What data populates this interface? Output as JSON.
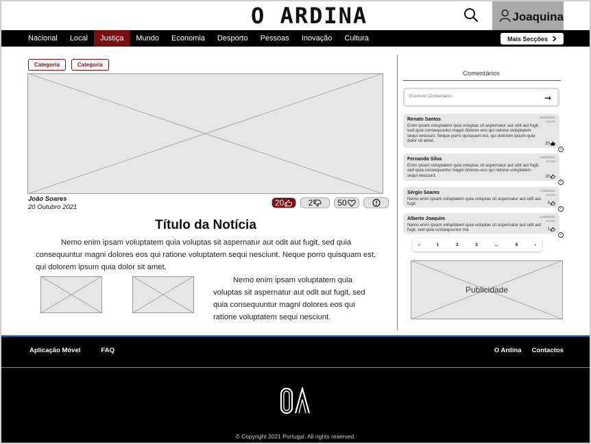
{
  "header": {
    "logo_text": "O ARDINA",
    "user_name": "Joaquina"
  },
  "nav": {
    "items": [
      {
        "label": "Nacional",
        "active": false
      },
      {
        "label": "Local",
        "active": false
      },
      {
        "label": "Justiça",
        "active": true
      },
      {
        "label": "Mundo",
        "active": false
      },
      {
        "label": "Economia",
        "active": false
      },
      {
        "label": "Desporto",
        "active": false
      },
      {
        "label": "Pessoas",
        "active": false
      },
      {
        "label": "Inovação",
        "active": false
      },
      {
        "label": "Cultura",
        "active": false
      }
    ],
    "more_label": "Mais Secções"
  },
  "article": {
    "categories": [
      "Categoria",
      "Categoria"
    ],
    "author": "João Soares",
    "date": "20 Outubro 2021",
    "likes": "20",
    "dislikes": "2",
    "favorites": "50",
    "title": "Título da Notícia",
    "paragraph1": "Nemo enim ipsam voluptatem quia voluptas sit aspernatur aut odit aut fugit, sed quia consequuntur magni dolores eos qui ratione voluptatem sequi nesciunt. Neque porro quisquam est, qui dolorem ipsum quia dolor sit amet.",
    "paragraph2": "Nemo enim ipsam voluptatem quia voluptas sit aspernatur aut odit aut fugit, sed quia consequuntur magni dolores eos qui ratione voluptatem sequi nesciunt."
  },
  "comments": {
    "title": "Comentários",
    "input_placeholder": "Escrever Comentário",
    "items": [
      {
        "name": "Renato Santos",
        "date": "04/10/2021",
        "time": "14:21h",
        "text": "Enim ipsam voluptatem quia voluptas sit aspernatur aut odit aut fugit, sed quia consequuntur magni dolores eos qui ratione voluptatem sequi nesciunt. Neque porro quisquam est, qui dolorem ipsum quia dolor sit amet.",
        "likes": "20"
      },
      {
        "name": "Fernando Silva",
        "date": "10/11/2021",
        "time": "14:21h",
        "text": "Enim ipsam voluptatem quia voluptas sit aspernatur aut odit aut fugit, sed quia consequuntur magni dolores eos qui ratione voluptatem sequi nesciunt.",
        "likes": "10"
      },
      {
        "name": "Sérgio Soares",
        "date": "17/09/2021",
        "time": "14:21h",
        "text": "Nemo enim ipsam voluptatem quia voluptas sit aspernatur aut odit aut fugit.",
        "likes": "0"
      },
      {
        "name": "Alberto Joaquim",
        "date": "12/09/2021",
        "time": "14:21h",
        "text": "Nemo enim ipsam voluptatem quia voluptas sit aspernatur aut odit aut fugit, sed quia consequuntur ma",
        "likes": "1"
      }
    ],
    "pagination": [
      "‹",
      "1",
      "2",
      "3",
      "...",
      "9",
      "›"
    ]
  },
  "ad": {
    "label": "Publicidade"
  },
  "footer": {
    "left_links": [
      "Aplicação Móvel",
      "FAQ"
    ],
    "right_links": [
      "O Ardina",
      "Contactos"
    ],
    "logo_text": "OA",
    "copyright": "© Copyright 2021 Portugal. All rights reserved."
  },
  "colors": {
    "accent": "#7a0e0e",
    "footer_bg": "#000000",
    "placeholder_bg": "#e6e6e6"
  }
}
